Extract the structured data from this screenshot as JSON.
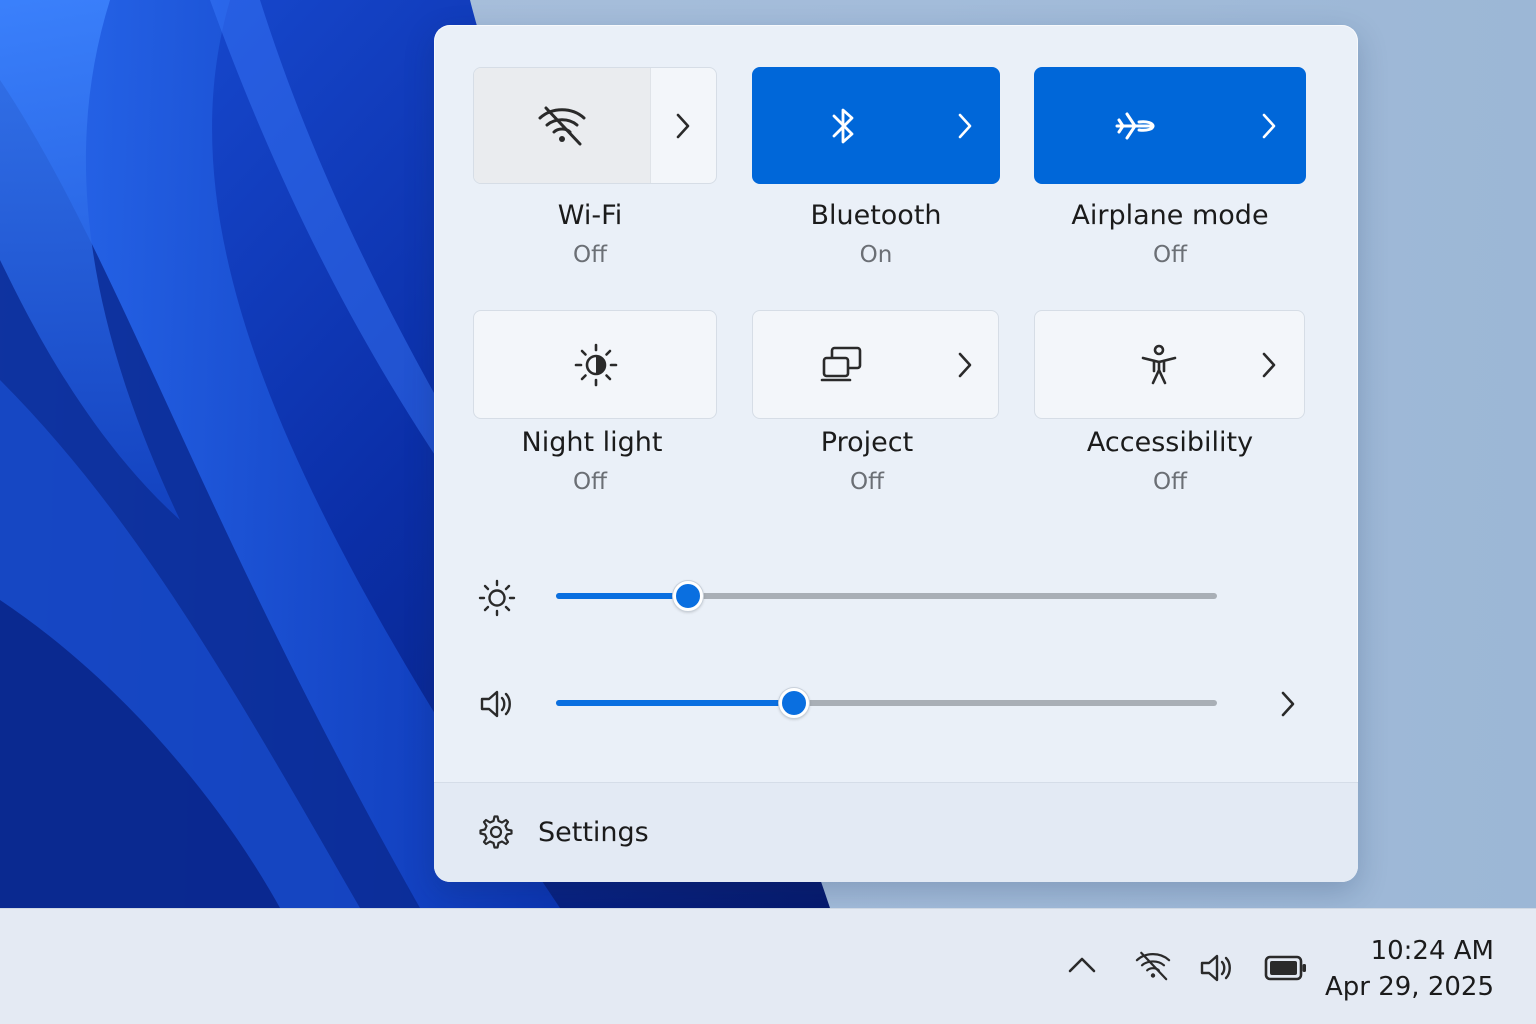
{
  "tiles": [
    {
      "label": "Wi-Fi",
      "state": "Off",
      "icon": "wifi-off-icon",
      "active": false,
      "has_chevron": true
    },
    {
      "label": "Bluetooth",
      "state": "On",
      "icon": "bluetooth-icon",
      "active": true,
      "has_chevron": true
    },
    {
      "label": "Airplane mode",
      "state": "Off",
      "icon": "airplane-icon",
      "active": true,
      "has_chevron": true
    },
    {
      "label": "Night light",
      "state": "Off",
      "icon": "night-light-icon",
      "active": false,
      "has_chevron": false
    },
    {
      "label": "Project",
      "state": "Off",
      "icon": "project-icon",
      "active": false,
      "has_chevron": true
    },
    {
      "label": "Accessibility",
      "state": "Off",
      "icon": "accessibility-icon",
      "active": false,
      "has_chevron": true
    }
  ],
  "sliders": {
    "brightness": {
      "icon": "brightness-icon",
      "level": 0.2
    },
    "volume": {
      "icon": "volume-icon",
      "level": 0.36
    }
  },
  "footer": {
    "settings_label": "Settings",
    "icon": "gear-icon"
  },
  "taskbar": {
    "tray_icons": [
      "chevron-up-icon",
      "wifi-off-icon",
      "volume-icon",
      "battery-icon"
    ],
    "time": "10:24 AM",
    "date": "Apr 29, 2025"
  },
  "colors": {
    "accent": "#0067d9",
    "panel_bg": "#eaf0f8",
    "taskbar_bg": "#e4eaf3"
  }
}
